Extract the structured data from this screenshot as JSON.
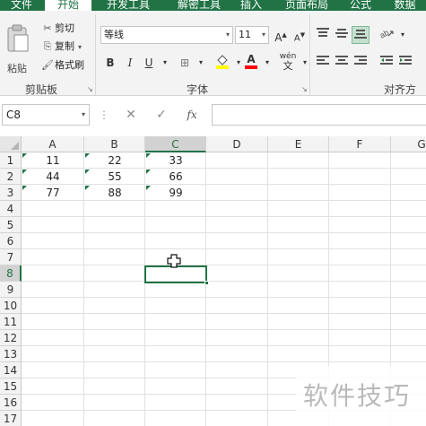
{
  "ribbon_tabs": [
    {
      "label": "文件",
      "active": false
    },
    {
      "label": "开始",
      "active": true
    },
    {
      "label": "开发工具",
      "active": false
    },
    {
      "label": "解密工具",
      "active": false
    },
    {
      "label": "插入",
      "active": false
    },
    {
      "label": "页面布局",
      "active": false
    },
    {
      "label": "公式",
      "active": false
    },
    {
      "label": "数据",
      "active": false
    }
  ],
  "clipboard": {
    "paste_label": "粘贴",
    "cut_label": "剪切",
    "copy_label": "复制",
    "format_painter_label": "格式刷",
    "group_label": "剪贴板"
  },
  "font": {
    "font_name": "等线",
    "font_size": "11",
    "bold_label": "B",
    "italic_label": "I",
    "underline_label": "U",
    "font_color_label": "A",
    "wen_label": "wén",
    "wen_char": "文",
    "group_label": "字体",
    "fill_color": "#ffff00",
    "font_color": "#ff0000"
  },
  "alignment": {
    "group_label": "对齐方式"
  },
  "formula_bar": {
    "name_box": "C8",
    "fx_label": "fx",
    "formula": ""
  },
  "sheet": {
    "columns": [
      "A",
      "B",
      "C",
      "D",
      "E",
      "F",
      "G"
    ],
    "selected_column": "C",
    "rows": [
      "1",
      "2",
      "3",
      "4",
      "5",
      "6",
      "7",
      "8",
      "9",
      "10",
      "11",
      "12",
      "13",
      "14",
      "15",
      "16",
      "17"
    ],
    "selected_row": "8",
    "cells": [
      [
        "11",
        "22",
        "33"
      ],
      [
        "44",
        "55",
        "66"
      ],
      [
        "77",
        "88",
        "99"
      ]
    ],
    "active_cell": "C8"
  },
  "watermark": "软件技巧",
  "colors": {
    "accent": "#217346"
  }
}
